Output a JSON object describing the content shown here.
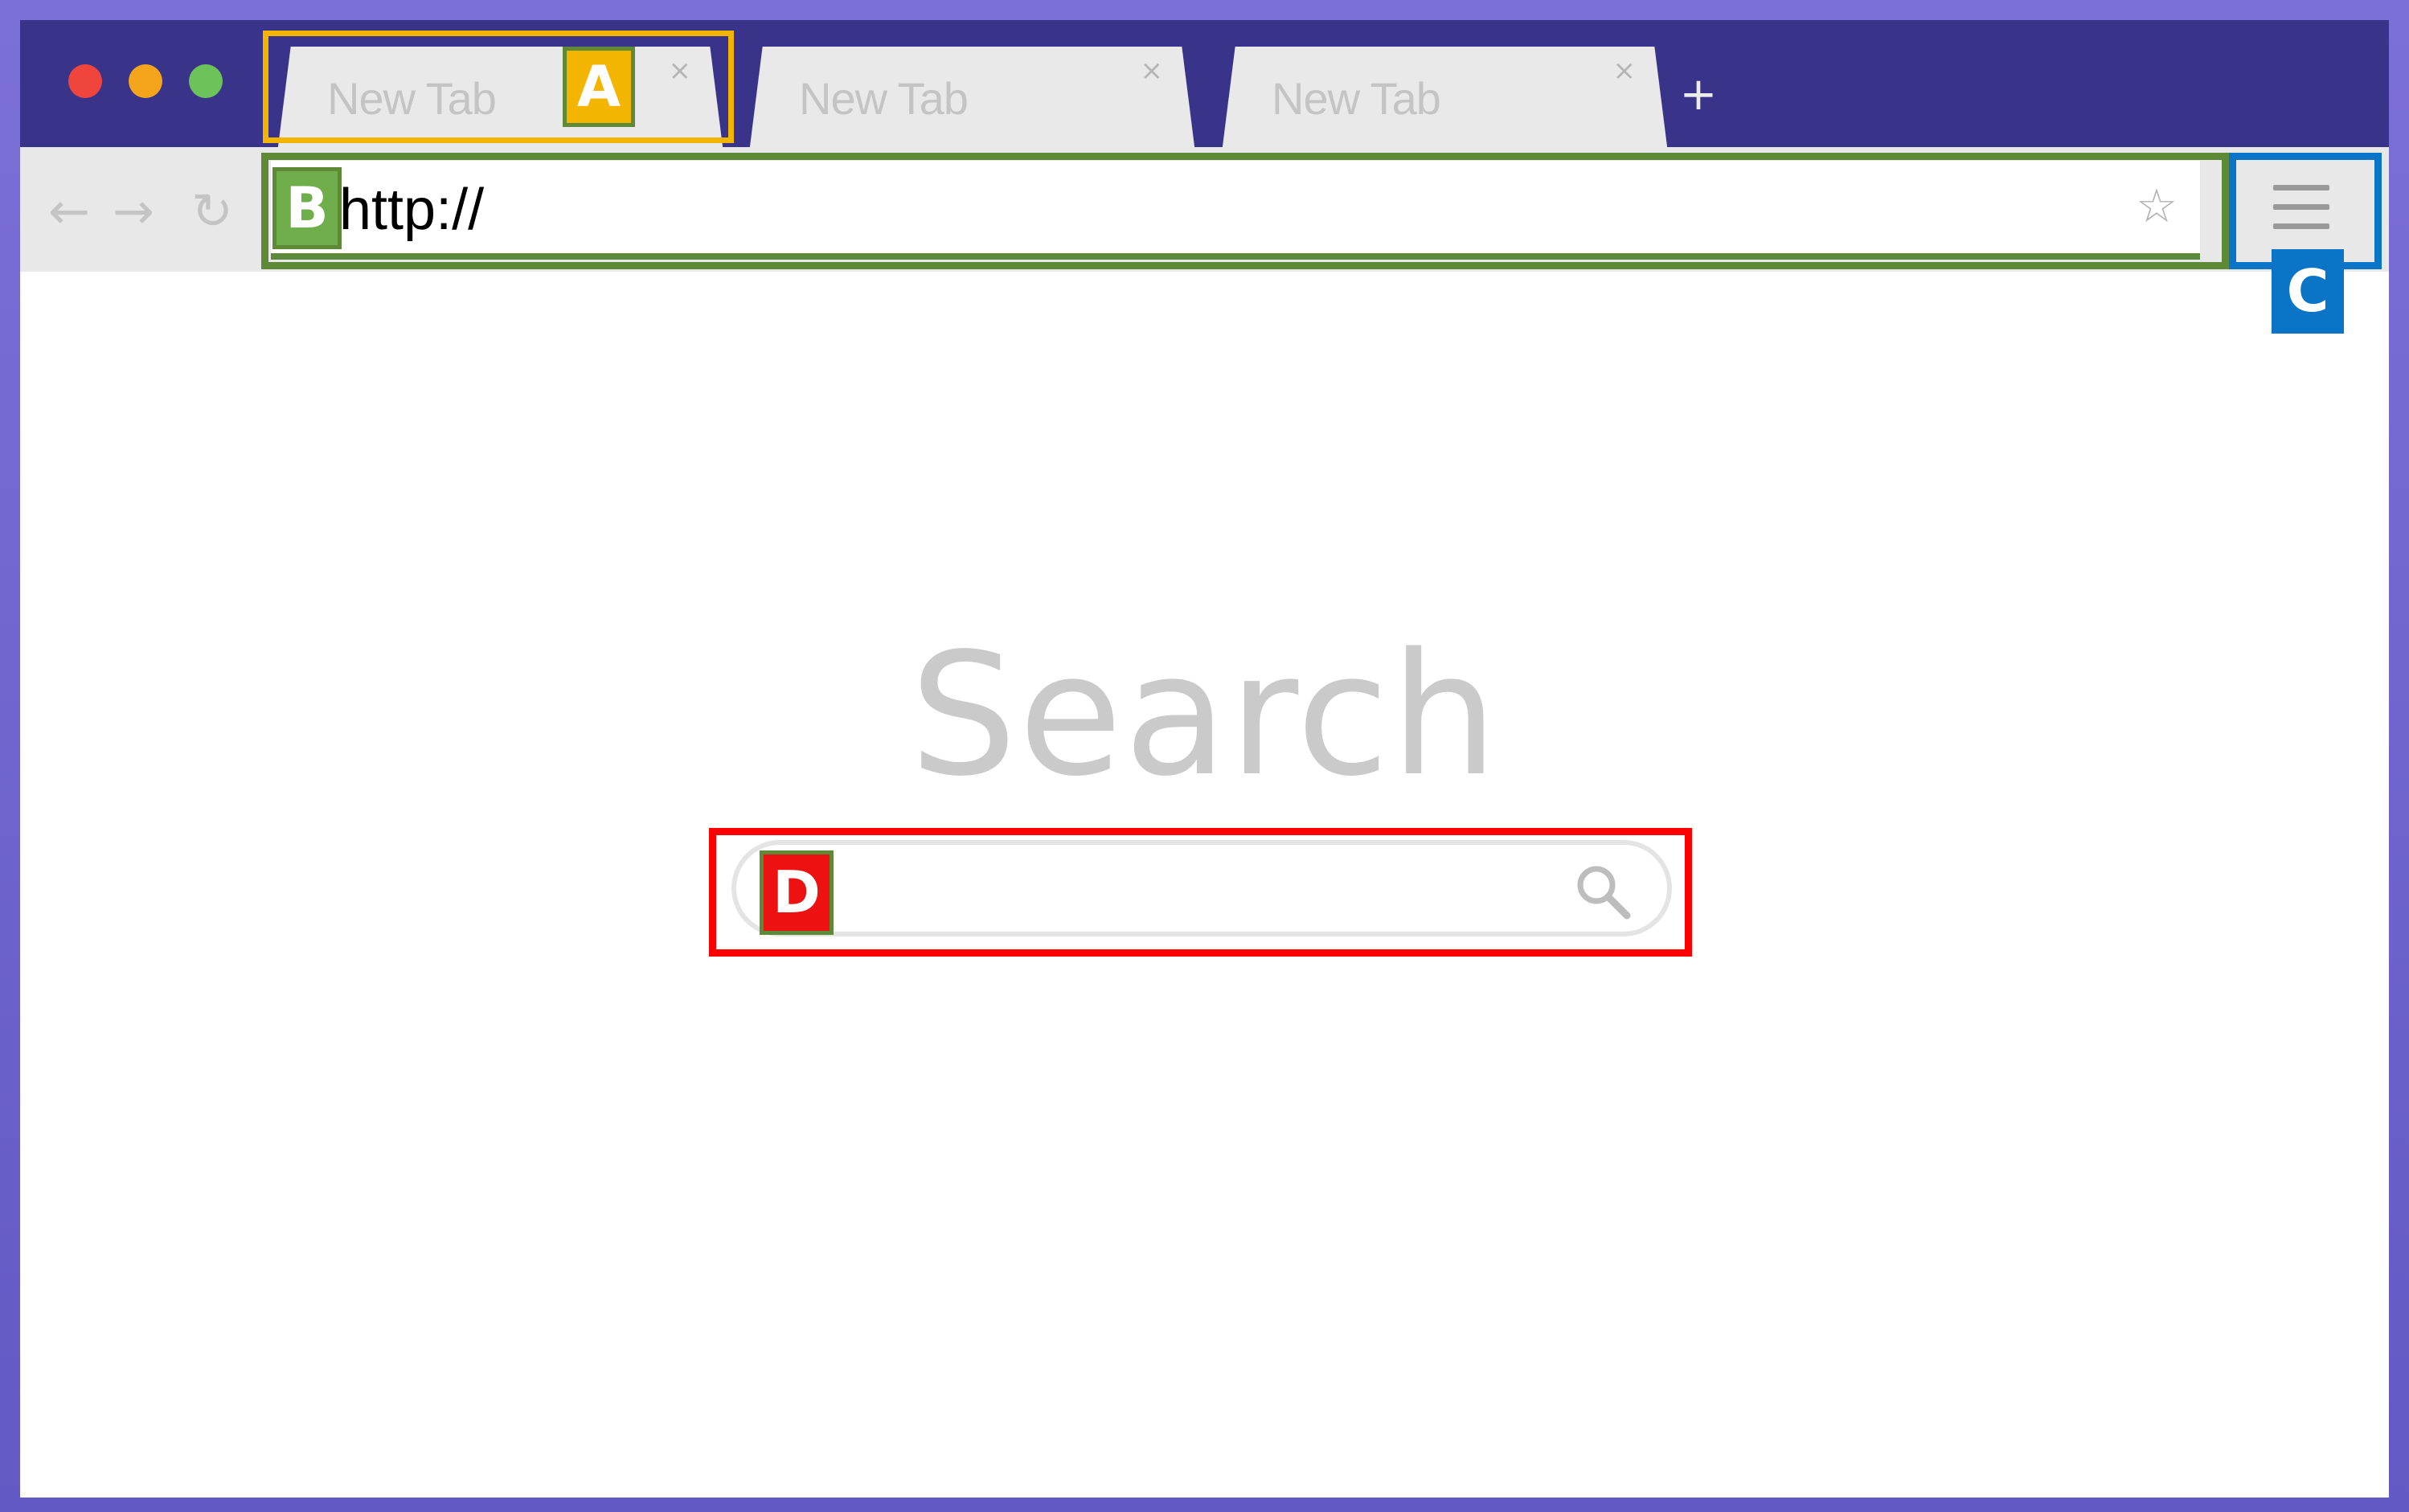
{
  "window": {
    "controls": [
      "close",
      "minimize",
      "maximize"
    ]
  },
  "tabs": [
    {
      "label": "New Tab",
      "close": "×"
    },
    {
      "label": "New Tab",
      "close": "×"
    },
    {
      "label": "New Tab",
      "close": "×"
    }
  ],
  "new_tab_label": "+",
  "toolbar": {
    "back_icon": "←",
    "forward_icon": "→",
    "reload_icon": "↻",
    "url": "http://",
    "bookmark_icon": "☆"
  },
  "page": {
    "title": "Search",
    "search_value": ""
  },
  "callouts": {
    "a": "A",
    "b": "B",
    "c": "C",
    "d": "D"
  },
  "colors": {
    "frame": "#6a62c8",
    "titlebar": "#3a338a",
    "callout_a": "#f4b500",
    "callout_b": "#5e8a37",
    "callout_c": "#0a74c6",
    "callout_d": "#ff0000"
  }
}
